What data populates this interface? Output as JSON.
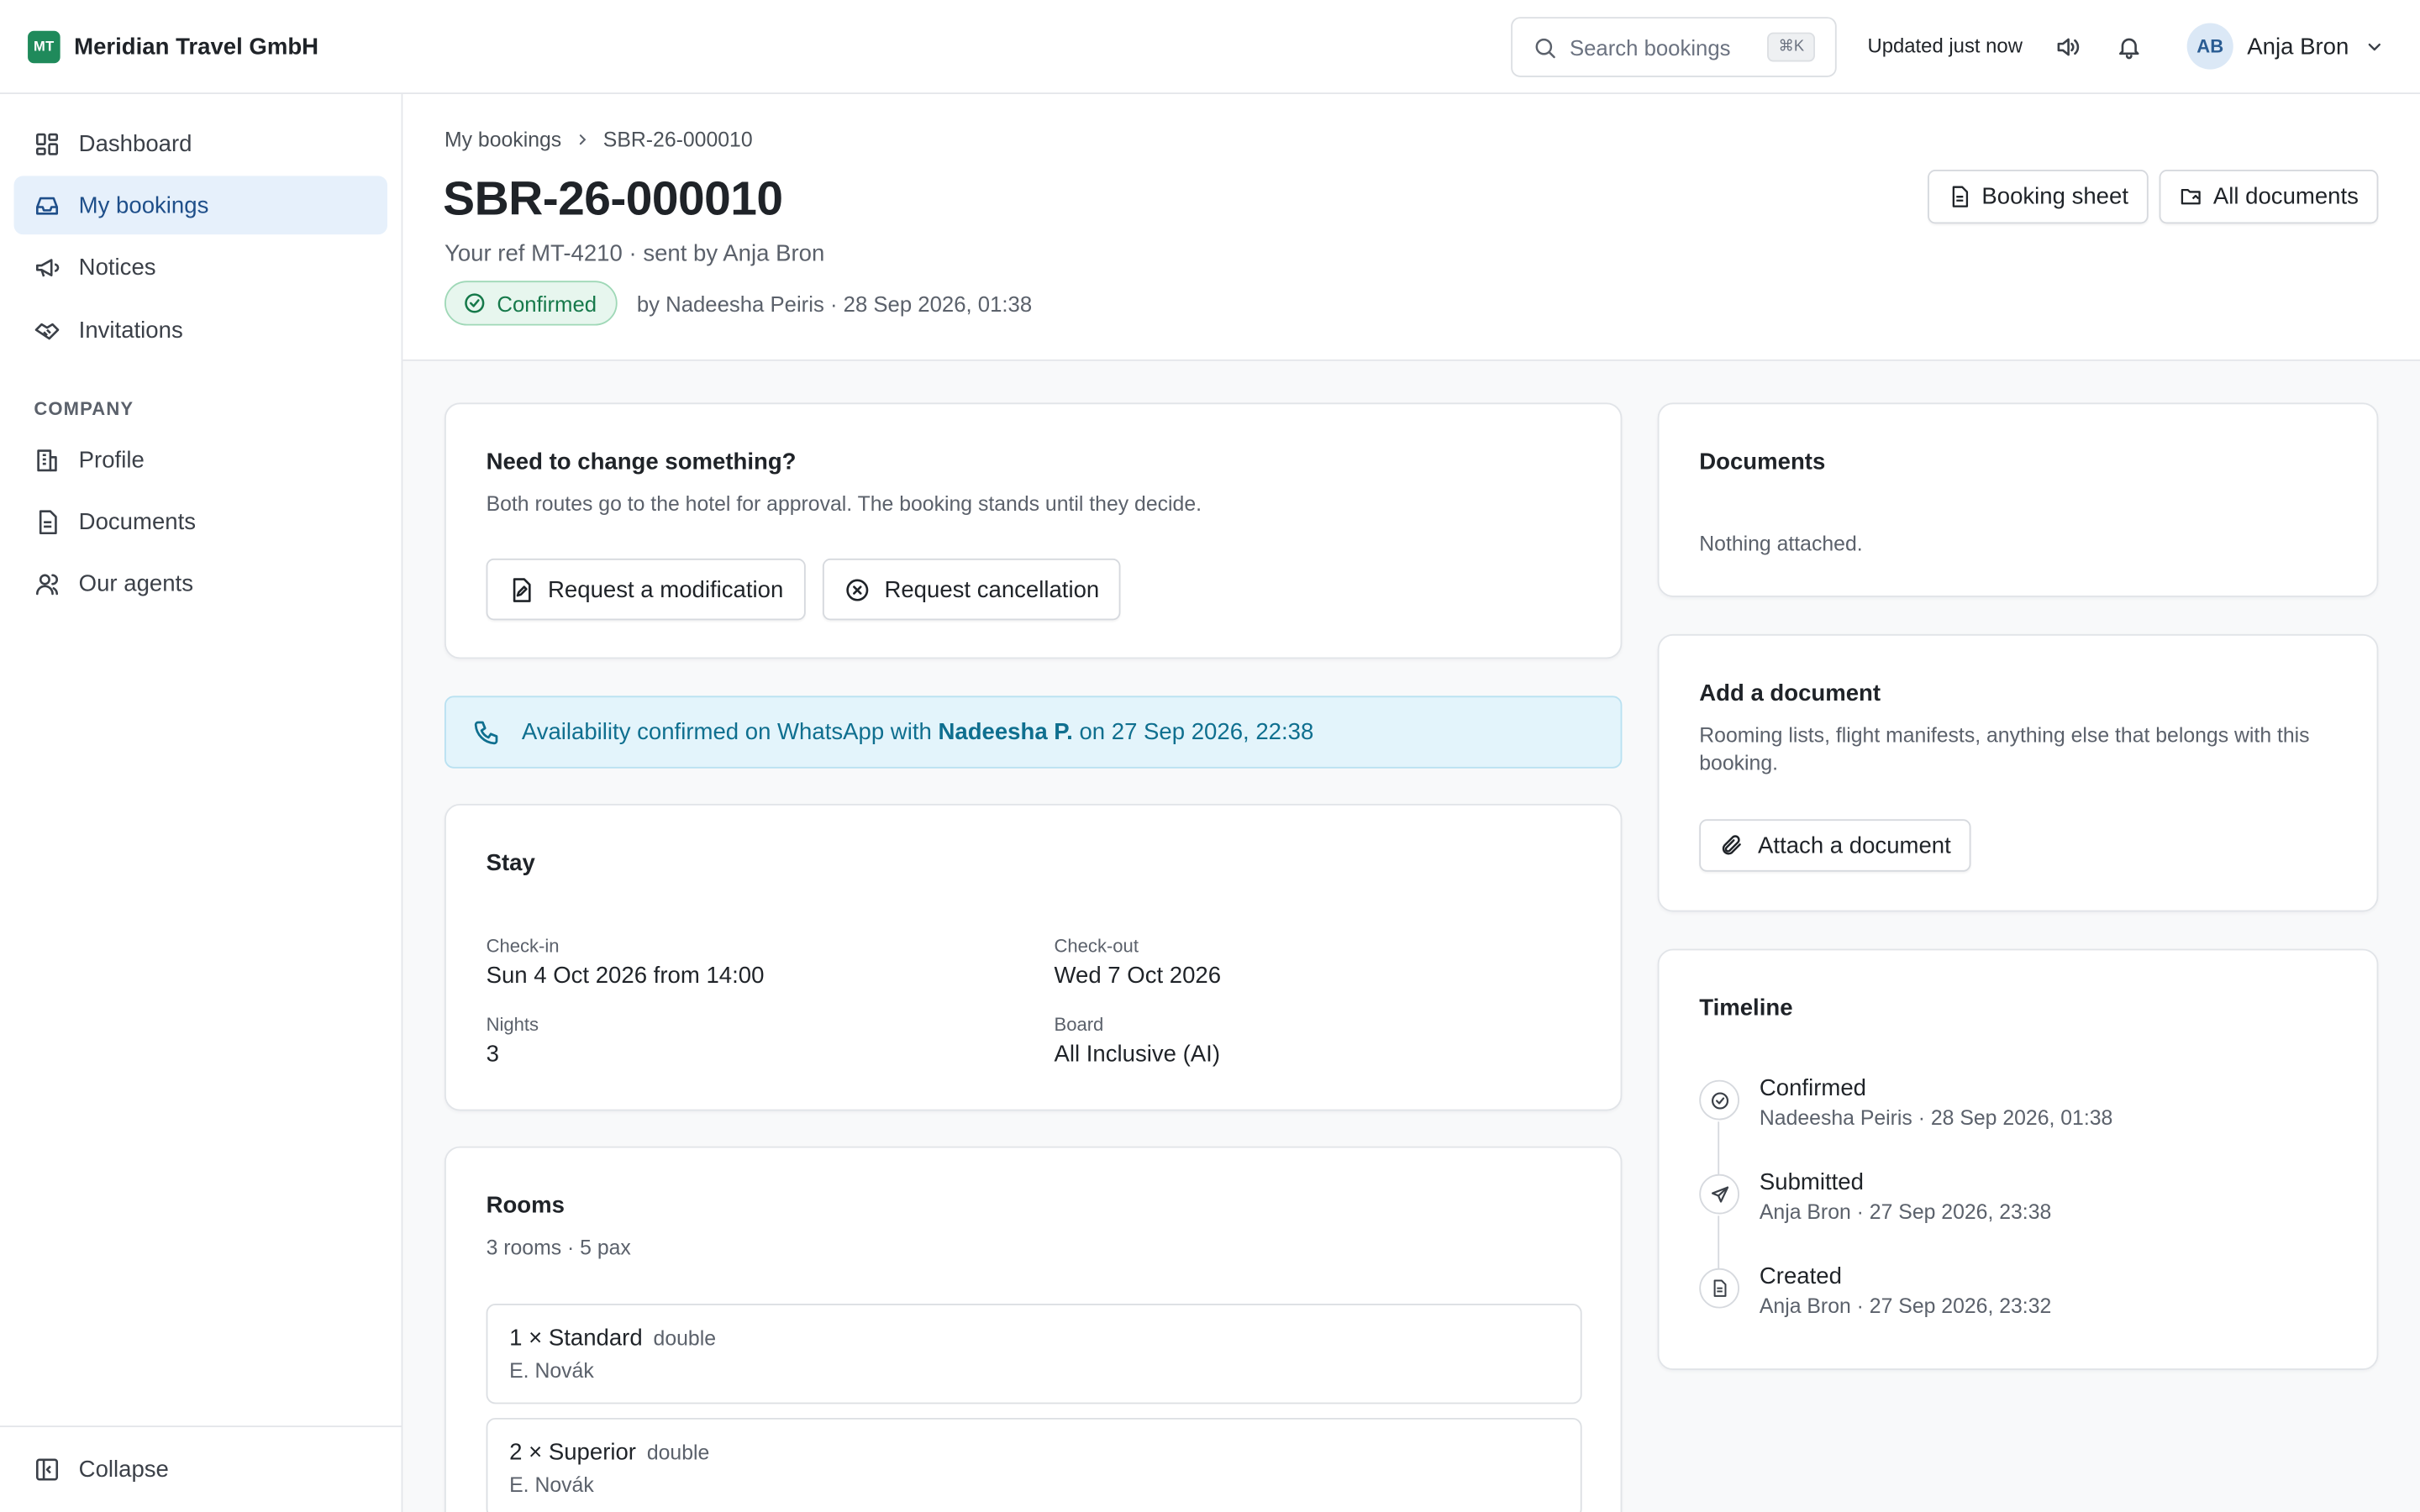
{
  "brand": {
    "initials": "MT",
    "name": "Meridian Travel GmbH",
    "color": "#1f8a5b"
  },
  "topbar": {
    "search_placeholder": "Search bookings",
    "search_shortcut": "⌘K",
    "updated_text": "Updated just now",
    "icons": [
      "search-icon",
      "speaker-icon",
      "bell-icon",
      "chevron-down-icon"
    ],
    "user": {
      "initials": "AB",
      "name": "Anja Bron"
    }
  },
  "sidebar": {
    "items": [
      {
        "label": "Dashboard",
        "icon": "dashboard-icon",
        "active": false
      },
      {
        "label": "My bookings",
        "icon": "inbox-icon",
        "active": true
      },
      {
        "label": "Notices",
        "icon": "megaphone-icon",
        "active": false
      },
      {
        "label": "Invitations",
        "icon": "handshake-icon",
        "active": false
      }
    ],
    "section_label": "COMPANY",
    "company_items": [
      {
        "label": "Profile",
        "icon": "building-icon"
      },
      {
        "label": "Documents",
        "icon": "file-icon"
      },
      {
        "label": "Our agents",
        "icon": "users-icon"
      }
    ],
    "collapse_label": "Collapse"
  },
  "header": {
    "breadcrumb": [
      "My bookings",
      "SBR-26-000010"
    ],
    "title": "SBR-26-000010",
    "subline": "Your ref MT-4210 · sent by Anja Bron",
    "status": "Confirmed",
    "status_color": "#16794a",
    "status_meta": "by Nadeesha Peiris · 28 Sep 2026, 01:38",
    "buttons": {
      "booking_sheet": "Booking sheet",
      "all_documents": "All documents"
    }
  },
  "change": {
    "title": "Need to change something?",
    "text": "Both routes go to the hotel for approval. The booking stands until they decide.",
    "modify_label": "Request a modification",
    "cancel_label": "Request cancellation"
  },
  "banner": {
    "prefix": "Availability confirmed on WhatsApp with",
    "contact": "Nadeesha P.",
    "suffix": "on 27 Sep 2026, 22:38"
  },
  "stay": {
    "title": "Stay",
    "checkin_label": "Check-in",
    "checkin_value": "Sun 4 Oct 2026 from 14:00",
    "checkout_label": "Check-out",
    "checkout_value": "Wed 7 Oct 2026",
    "nights_label": "Nights",
    "nights_value": "3",
    "board_label": "Board",
    "board_value": "All Inclusive (AI)"
  },
  "rooms": {
    "title": "Rooms",
    "summary": "3 rooms · 5 pax",
    "list": [
      {
        "title": "1 × Standard",
        "type": "double",
        "guest": "E. Novák"
      },
      {
        "title": "2 × Superior",
        "type": "double",
        "guest": "E. Novák"
      }
    ]
  },
  "documents": {
    "title": "Documents",
    "empty_text": "Nothing attached."
  },
  "add_document": {
    "title": "Add a document",
    "text": "Rooming lists, flight manifests, anything else that belongs with this booking.",
    "button_label": "Attach a document"
  },
  "timeline": {
    "title": "Timeline",
    "events": [
      {
        "title": "Confirmed",
        "meta": "Nadeesha Peiris · 28 Sep 2026, 01:38",
        "icon": "check-circle-icon"
      },
      {
        "title": "Submitted",
        "meta": "Anja Bron · 27 Sep 2026, 23:38",
        "icon": "send-icon"
      },
      {
        "title": "Created",
        "meta": "Anja Bron · 27 Sep 2026, 23:32",
        "icon": "file-icon"
      }
    ]
  }
}
